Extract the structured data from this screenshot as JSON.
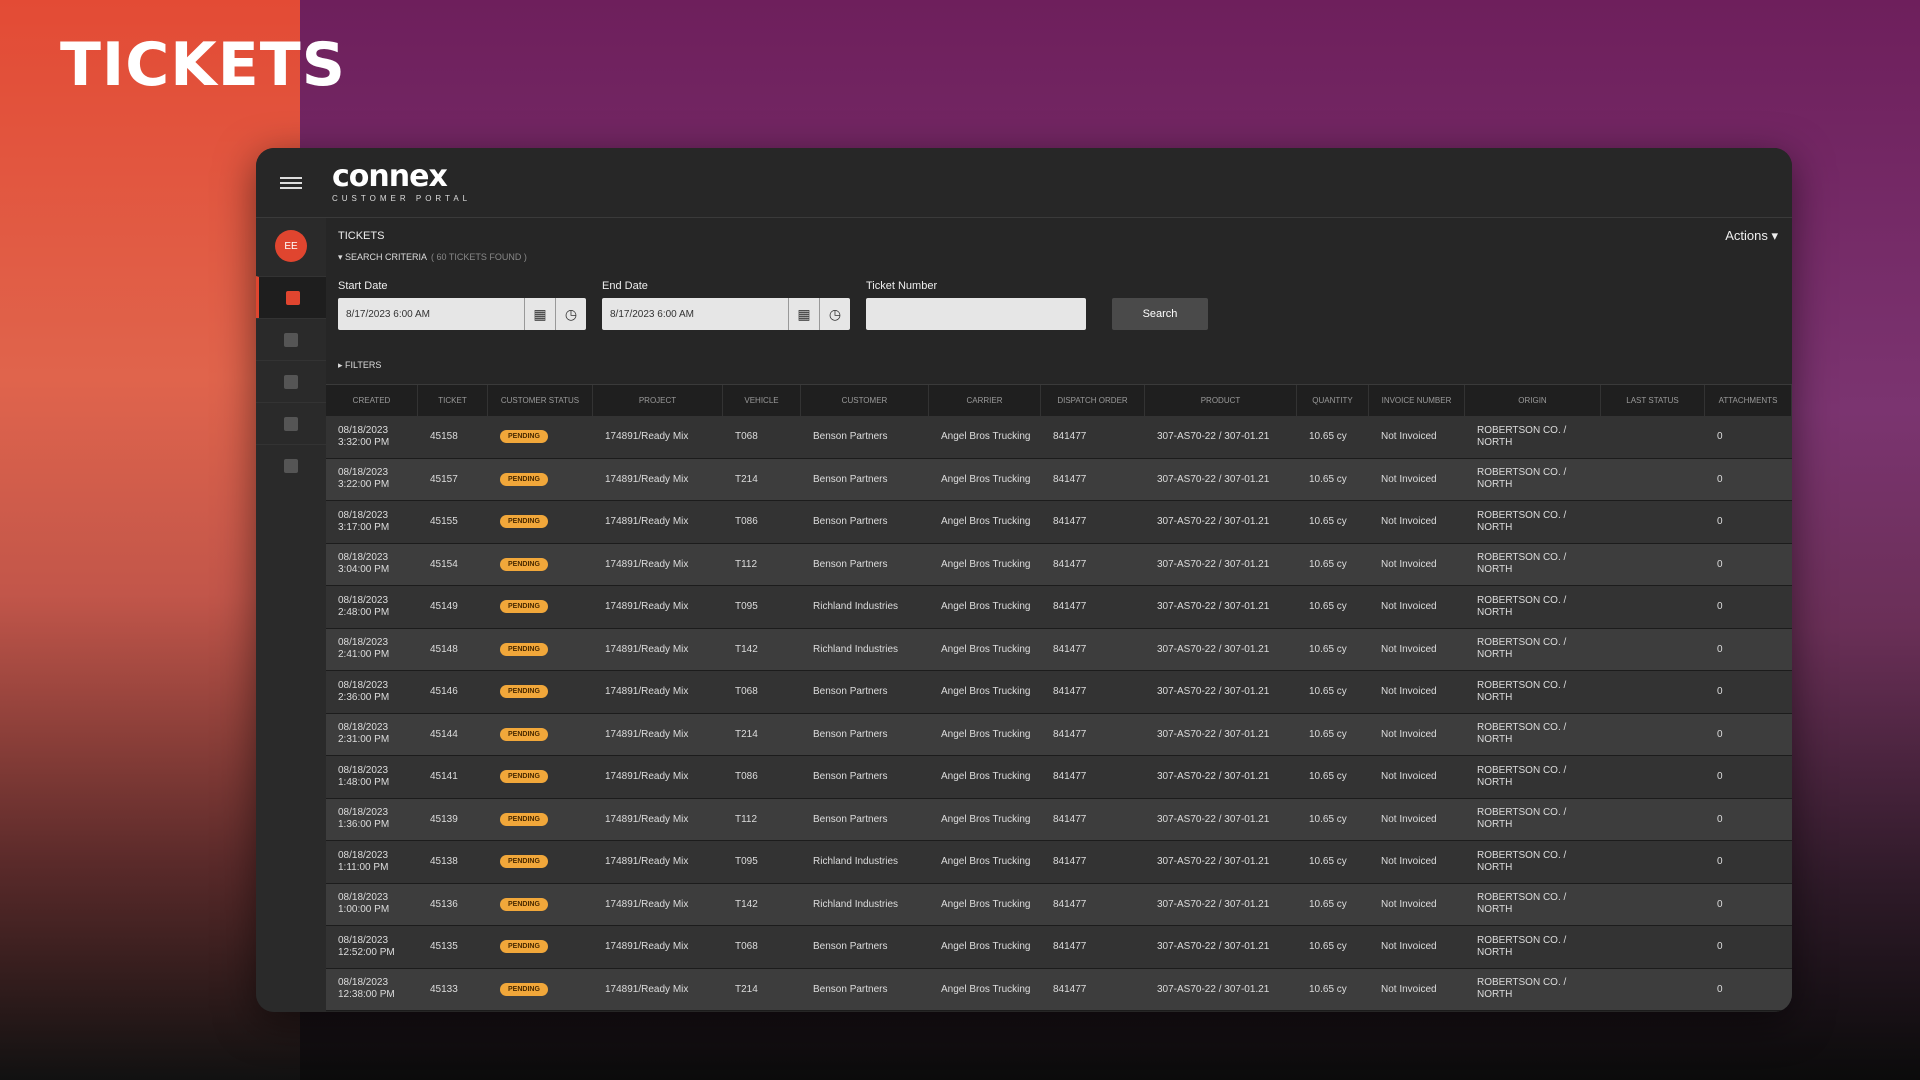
{
  "hero": {
    "title": "TICKETS"
  },
  "app": {
    "logo": "connex",
    "logo_sub": "CUSTOMER PORTAL"
  },
  "user": {
    "initials": "EE"
  },
  "sidebar": {
    "items": [
      "tickets-icon",
      "tag-icon",
      "list-icon",
      "share-icon",
      "people-icon"
    ]
  },
  "page": {
    "title": "TICKETS",
    "criteria_label": "SEARCH CRITERIA",
    "count": "( 60 TICKETS FOUND )",
    "actions": "Actions ▾",
    "filters": "▸ FILTERS"
  },
  "search": {
    "start_label": "Start Date",
    "start_value": "8/17/2023 6:00 AM",
    "end_label": "End Date",
    "end_value": "8/17/2023 6:00 AM",
    "ticket_label": "Ticket Number",
    "ticket_value": "",
    "button": "Search"
  },
  "table": {
    "columns": [
      "CREATED",
      "TICKET",
      "CUSTOMER STATUS",
      "PROJECT",
      "VEHICLE",
      "CUSTOMER",
      "CARRIER",
      "DISPATCH ORDER",
      "PRODUCT",
      "QUANTITY",
      "INVOICE NUMBER",
      "ORIGIN",
      "LAST STATUS",
      "ATTACHMENTS"
    ],
    "rows": [
      {
        "date": "08/18/2023",
        "time": "3:32:00 PM",
        "ticket": "45158",
        "status": "PENDING",
        "project": "174891/Ready Mix",
        "vehicle": "T068",
        "customer": "Benson Partners",
        "carrier": "Angel Bros Trucking",
        "order": "841477",
        "product": "307-AS70-22 / 307-01.21",
        "quantity": "10.65 cy",
        "invoice": "Not Invoiced",
        "origin": "ROBERTSON CO. / NORTH",
        "last_status": "",
        "attachments": "0"
      },
      {
        "date": "08/18/2023",
        "time": "3:22:00 PM",
        "ticket": "45157",
        "status": "PENDING",
        "project": "174891/Ready Mix",
        "vehicle": "T214",
        "customer": "Benson Partners",
        "carrier": "Angel Bros Trucking",
        "order": "841477",
        "product": "307-AS70-22 / 307-01.21",
        "quantity": "10.65 cy",
        "invoice": "Not Invoiced",
        "origin": "ROBERTSON CO. / NORTH",
        "last_status": "",
        "attachments": "0"
      },
      {
        "date": "08/18/2023",
        "time": "3:17:00 PM",
        "ticket": "45155",
        "status": "PENDING",
        "project": "174891/Ready Mix",
        "vehicle": "T086",
        "customer": "Benson Partners",
        "carrier": "Angel Bros Trucking",
        "order": "841477",
        "product": "307-AS70-22 / 307-01.21",
        "quantity": "10.65 cy",
        "invoice": "Not Invoiced",
        "origin": "ROBERTSON CO. / NORTH",
        "last_status": "",
        "attachments": "0"
      },
      {
        "date": "08/18/2023",
        "time": "3:04:00 PM",
        "ticket": "45154",
        "status": "PENDING",
        "project": "174891/Ready Mix",
        "vehicle": "T112",
        "customer": "Benson Partners",
        "carrier": "Angel Bros Trucking",
        "order": "841477",
        "product": "307-AS70-22 / 307-01.21",
        "quantity": "10.65 cy",
        "invoice": "Not Invoiced",
        "origin": "ROBERTSON CO. / NORTH",
        "last_status": "",
        "attachments": "0"
      },
      {
        "date": "08/18/2023",
        "time": "2:48:00 PM",
        "ticket": "45149",
        "status": "PENDING",
        "project": "174891/Ready Mix",
        "vehicle": "T095",
        "customer": "Richland Industries",
        "carrier": "Angel Bros Trucking",
        "order": "841477",
        "product": "307-AS70-22 / 307-01.21",
        "quantity": "10.65 cy",
        "invoice": "Not Invoiced",
        "origin": "ROBERTSON CO. / NORTH",
        "last_status": "",
        "attachments": "0"
      },
      {
        "date": "08/18/2023",
        "time": "2:41:00 PM",
        "ticket": "45148",
        "status": "PENDING",
        "project": "174891/Ready Mix",
        "vehicle": "T142",
        "customer": "Richland Industries",
        "carrier": "Angel Bros Trucking",
        "order": "841477",
        "product": "307-AS70-22 / 307-01.21",
        "quantity": "10.65 cy",
        "invoice": "Not Invoiced",
        "origin": "ROBERTSON CO. / NORTH",
        "last_status": "",
        "attachments": "0"
      },
      {
        "date": "08/18/2023",
        "time": "2:36:00 PM",
        "ticket": "45146",
        "status": "PENDING",
        "project": "174891/Ready Mix",
        "vehicle": "T068",
        "customer": "Benson Partners",
        "carrier": "Angel Bros Trucking",
        "order": "841477",
        "product": "307-AS70-22 / 307-01.21",
        "quantity": "10.65 cy",
        "invoice": "Not Invoiced",
        "origin": "ROBERTSON CO. / NORTH",
        "last_status": "",
        "attachments": "0"
      },
      {
        "date": "08/18/2023",
        "time": "2:31:00 PM",
        "ticket": "45144",
        "status": "PENDING",
        "project": "174891/Ready Mix",
        "vehicle": "T214",
        "customer": "Benson Partners",
        "carrier": "Angel Bros Trucking",
        "order": "841477",
        "product": "307-AS70-22 / 307-01.21",
        "quantity": "10.65 cy",
        "invoice": "Not Invoiced",
        "origin": "ROBERTSON CO. / NORTH",
        "last_status": "",
        "attachments": "0"
      },
      {
        "date": "08/18/2023",
        "time": "1:48:00 PM",
        "ticket": "45141",
        "status": "PENDING",
        "project": "174891/Ready Mix",
        "vehicle": "T086",
        "customer": "Benson Partners",
        "carrier": "Angel Bros Trucking",
        "order": "841477",
        "product": "307-AS70-22 / 307-01.21",
        "quantity": "10.65 cy",
        "invoice": "Not Invoiced",
        "origin": "ROBERTSON CO. / NORTH",
        "last_status": "",
        "attachments": "0"
      },
      {
        "date": "08/18/2023",
        "time": "1:36:00 PM",
        "ticket": "45139",
        "status": "PENDING",
        "project": "174891/Ready Mix",
        "vehicle": "T112",
        "customer": "Benson Partners",
        "carrier": "Angel Bros Trucking",
        "order": "841477",
        "product": "307-AS70-22 / 307-01.21",
        "quantity": "10.65 cy",
        "invoice": "Not Invoiced",
        "origin": "ROBERTSON CO. / NORTH",
        "last_status": "",
        "attachments": "0"
      },
      {
        "date": "08/18/2023",
        "time": "1:11:00 PM",
        "ticket": "45138",
        "status": "PENDING",
        "project": "174891/Ready Mix",
        "vehicle": "T095",
        "customer": "Richland Industries",
        "carrier": "Angel Bros Trucking",
        "order": "841477",
        "product": "307-AS70-22 / 307-01.21",
        "quantity": "10.65 cy",
        "invoice": "Not Invoiced",
        "origin": "ROBERTSON CO. / NORTH",
        "last_status": "",
        "attachments": "0"
      },
      {
        "date": "08/18/2023",
        "time": "1:00:00 PM",
        "ticket": "45136",
        "status": "PENDING",
        "project": "174891/Ready Mix",
        "vehicle": "T142",
        "customer": "Richland Industries",
        "carrier": "Angel Bros Trucking",
        "order": "841477",
        "product": "307-AS70-22 / 307-01.21",
        "quantity": "10.65 cy",
        "invoice": "Not Invoiced",
        "origin": "ROBERTSON CO. / NORTH",
        "last_status": "",
        "attachments": "0"
      },
      {
        "date": "08/18/2023",
        "time": "12:52:00 PM",
        "ticket": "45135",
        "status": "PENDING",
        "project": "174891/Ready Mix",
        "vehicle": "T068",
        "customer": "Benson Partners",
        "carrier": "Angel Bros Trucking",
        "order": "841477",
        "product": "307-AS70-22 / 307-01.21",
        "quantity": "10.65 cy",
        "invoice": "Not Invoiced",
        "origin": "ROBERTSON CO. / NORTH",
        "last_status": "",
        "attachments": "0"
      },
      {
        "date": "08/18/2023",
        "time": "12:38:00 PM",
        "ticket": "45133",
        "status": "PENDING",
        "project": "174891/Ready Mix",
        "vehicle": "T214",
        "customer": "Benson Partners",
        "carrier": "Angel Bros Trucking",
        "order": "841477",
        "product": "307-AS70-22 / 307-01.21",
        "quantity": "10.65 cy",
        "invoice": "Not Invoiced",
        "origin": "ROBERTSON CO. / NORTH",
        "last_status": "",
        "attachments": "0"
      }
    ]
  },
  "colors": {
    "accent": "#e0452f",
    "badge": "#f1a73a"
  }
}
